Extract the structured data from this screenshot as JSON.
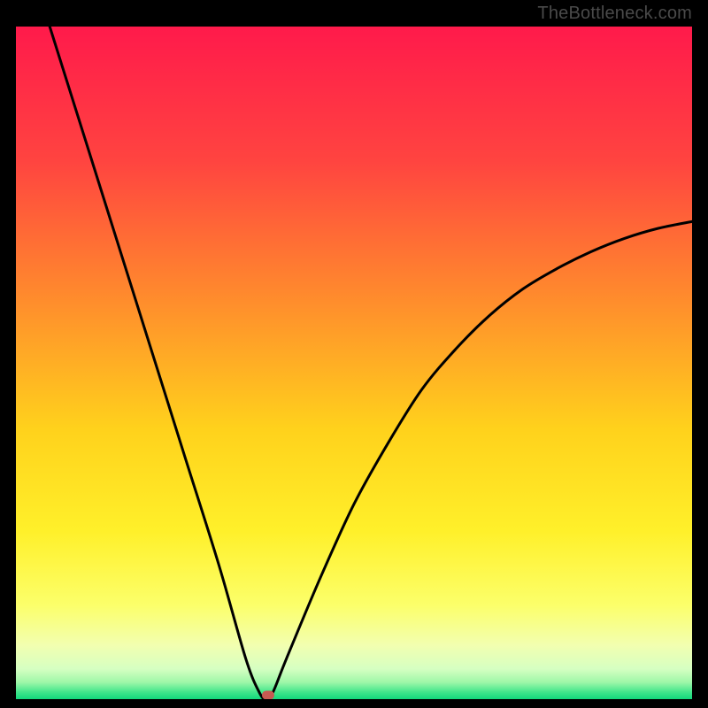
{
  "attribution": "TheBottleneck.com",
  "chart_data": {
    "type": "line",
    "title": "",
    "xlabel": "",
    "ylabel": "",
    "x_range": [
      0,
      100
    ],
    "y_range": [
      0,
      100
    ],
    "curve": {
      "name": "bottleneck-curve",
      "x": [
        5,
        10,
        15,
        20,
        25,
        30,
        34,
        36,
        37,
        38,
        40,
        45,
        50,
        55,
        60,
        65,
        70,
        75,
        80,
        85,
        90,
        95,
        100
      ],
      "y": [
        100,
        84,
        68,
        52,
        36,
        20,
        6,
        1,
        0,
        1,
        6,
        18,
        29,
        38,
        46,
        52,
        57,
        61,
        64,
        66.5,
        68.5,
        70,
        71
      ]
    },
    "marker": {
      "x": 37.3,
      "y": 0.6
    },
    "background": {
      "type": "vertical-gradient",
      "stops": [
        {
          "pos": 0.0,
          "color": "#ff1a4b"
        },
        {
          "pos": 0.2,
          "color": "#ff4440"
        },
        {
          "pos": 0.4,
          "color": "#ff8a2d"
        },
        {
          "pos": 0.6,
          "color": "#ffd21c"
        },
        {
          "pos": 0.75,
          "color": "#fff02a"
        },
        {
          "pos": 0.86,
          "color": "#fcff6a"
        },
        {
          "pos": 0.92,
          "color": "#f2ffb0"
        },
        {
          "pos": 0.955,
          "color": "#d6ffc2"
        },
        {
          "pos": 0.975,
          "color": "#9ef7a8"
        },
        {
          "pos": 0.99,
          "color": "#3fe58a"
        },
        {
          "pos": 1.0,
          "color": "#12d87c"
        }
      ]
    }
  }
}
